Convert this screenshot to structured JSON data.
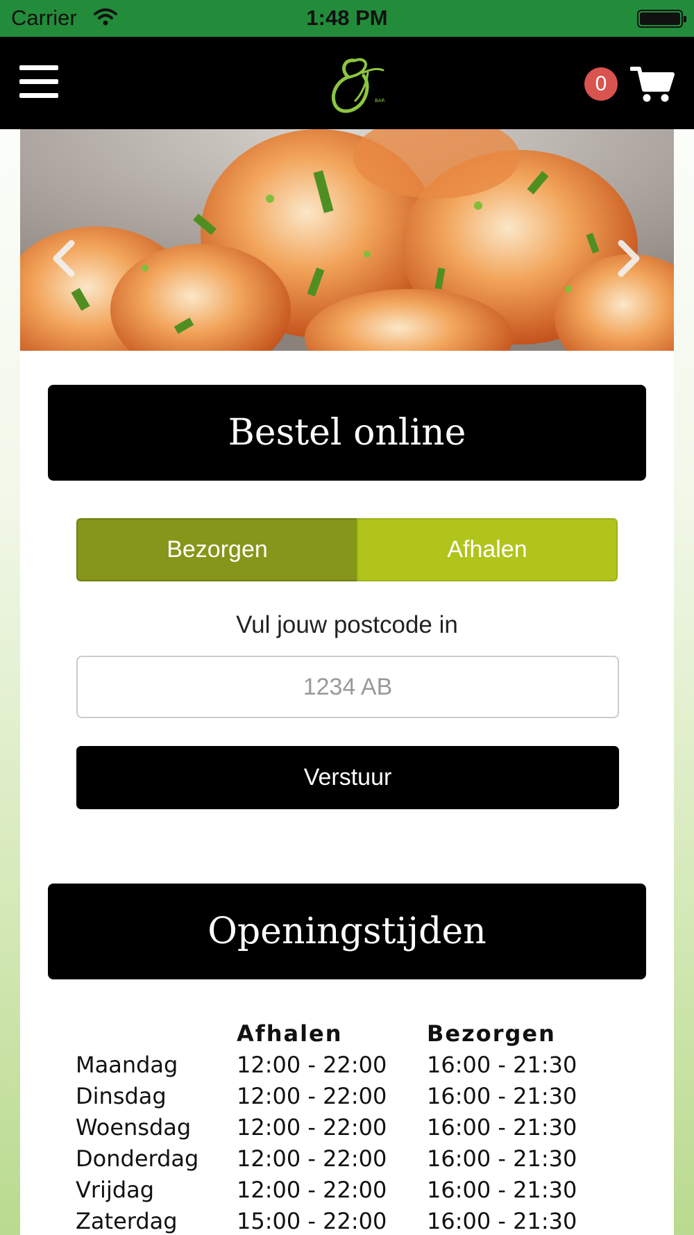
{
  "status_bar": {
    "carrier": "Carrier",
    "time": "1:48 PM"
  },
  "navbar": {
    "menu_icon": "hamburger-menu-icon",
    "logo_icon": "restaurant-logo",
    "cart_count": "0",
    "cart_icon": "shopping-cart-icon",
    "background": "#000000"
  },
  "carousel": {
    "image": "garlic shrimp photo",
    "prev_icon": "chevron-left-icon",
    "next_icon": "chevron-right-icon"
  },
  "order_section": {
    "title": "Bestel online",
    "tabs": [
      {
        "label": "Bezorgen",
        "selected": true
      },
      {
        "label": "Afhalen",
        "selected": false
      }
    ],
    "postcode_label": "Vul jouw postcode in",
    "postcode_placeholder": "1234 AB",
    "submit_label": "Verstuur"
  },
  "hours_section": {
    "title": "Openingstijden",
    "columns": [
      "",
      "Afhalen",
      "Bezorgen"
    ],
    "rows": [
      {
        "day": "Maandag",
        "pickup": "12:00 - 22:00",
        "delivery": "16:00 - 21:30"
      },
      {
        "day": "Dinsdag",
        "pickup": "12:00 - 22:00",
        "delivery": "16:00 - 21:30"
      },
      {
        "day": "Woensdag",
        "pickup": "12:00 - 22:00",
        "delivery": "16:00 - 21:30"
      },
      {
        "day": "Donderdag",
        "pickup": "12:00 - 22:00",
        "delivery": "16:00 - 21:30"
      },
      {
        "day": "Vrijdag",
        "pickup": "12:00 - 22:00",
        "delivery": "16:00 - 21:30"
      },
      {
        "day": "Zaterdag",
        "pickup": "15:00 - 22:00",
        "delivery": "16:00 - 21:30"
      }
    ]
  },
  "colors": {
    "status_bar": "#238c3a",
    "toggle_selected": "#86961a",
    "toggle_unselected": "#b1c41c",
    "badge": "#d9534f",
    "logo_green": "#8dc63f"
  }
}
